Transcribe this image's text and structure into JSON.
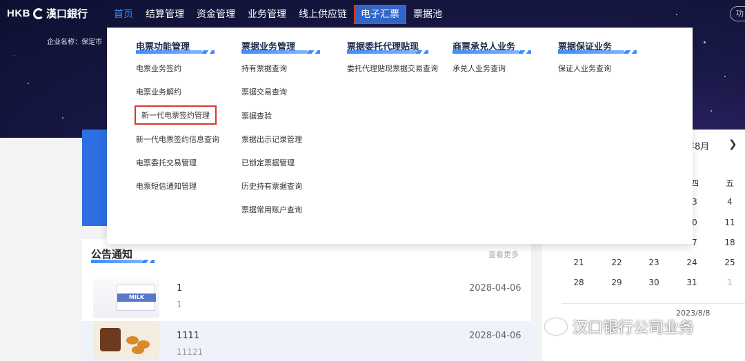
{
  "header": {
    "logo_text": "HKB",
    "logo_cn": "漢口銀行",
    "nav": [
      "首页",
      "结算管理",
      "资金管理",
      "业务管理",
      "线上供应链",
      "电子汇票",
      "票据池"
    ],
    "right_button": "功",
    "company_label": "企业名称：保定市"
  },
  "menu": {
    "columns": [
      {
        "title": "电票功能管理",
        "items": [
          "电票业务签约",
          "电票业务解约",
          "新一代电票签约管理",
          "新一代电票签约信息查询",
          "电票委托交易管理",
          "电票短信通知管理"
        ]
      },
      {
        "title": "票据业务管理",
        "items": [
          "持有票据查询",
          "票据交易查询",
          "票据查验",
          "票据出示记录管理",
          "已锁定票据管理",
          "历史持有票据查询",
          "票据常用账户查询"
        ]
      },
      {
        "title": "票据委托代理贴现",
        "items": [
          "委托代理贴现票据交易查询"
        ]
      },
      {
        "title": "商票承兑人业务",
        "items": [
          "承兑人业务查询"
        ]
      },
      {
        "title": "票据保证业务",
        "items": [
          "保证人业务查询"
        ]
      }
    ]
  },
  "notice": {
    "title": "公告通知",
    "more": "查看更多",
    "items": [
      {
        "title": "1",
        "sub": "1",
        "date": "2028-04-06",
        "thumb": "milk-carton",
        "thumb_text": "MILK"
      },
      {
        "title": "1111",
        "sub": "11121",
        "date": "2028-04-06",
        "thumb": "food-plate"
      }
    ]
  },
  "calendar": {
    "month_label": "年8月",
    "next_icon": "chevron-right-icon",
    "weekdays": [
      "四",
      "五"
    ],
    "rows": [
      [
        "3",
        "4"
      ],
      [
        "0",
        "11"
      ],
      [
        "7",
        "18"
      ],
      [
        "21",
        "22",
        "23",
        "24",
        "25"
      ],
      [
        "28",
        "29",
        "30",
        "31",
        "1"
      ]
    ],
    "selected_date": "2023/8/8"
  },
  "watermark": {
    "text": "汉口银行公司业务",
    "icon": "wechat-icon"
  },
  "colors": {
    "accent": "#3c8cff",
    "nav_highlight": "#2f66c9",
    "highlight_border": "#d9372c",
    "banner_dark": "#0c1030"
  }
}
